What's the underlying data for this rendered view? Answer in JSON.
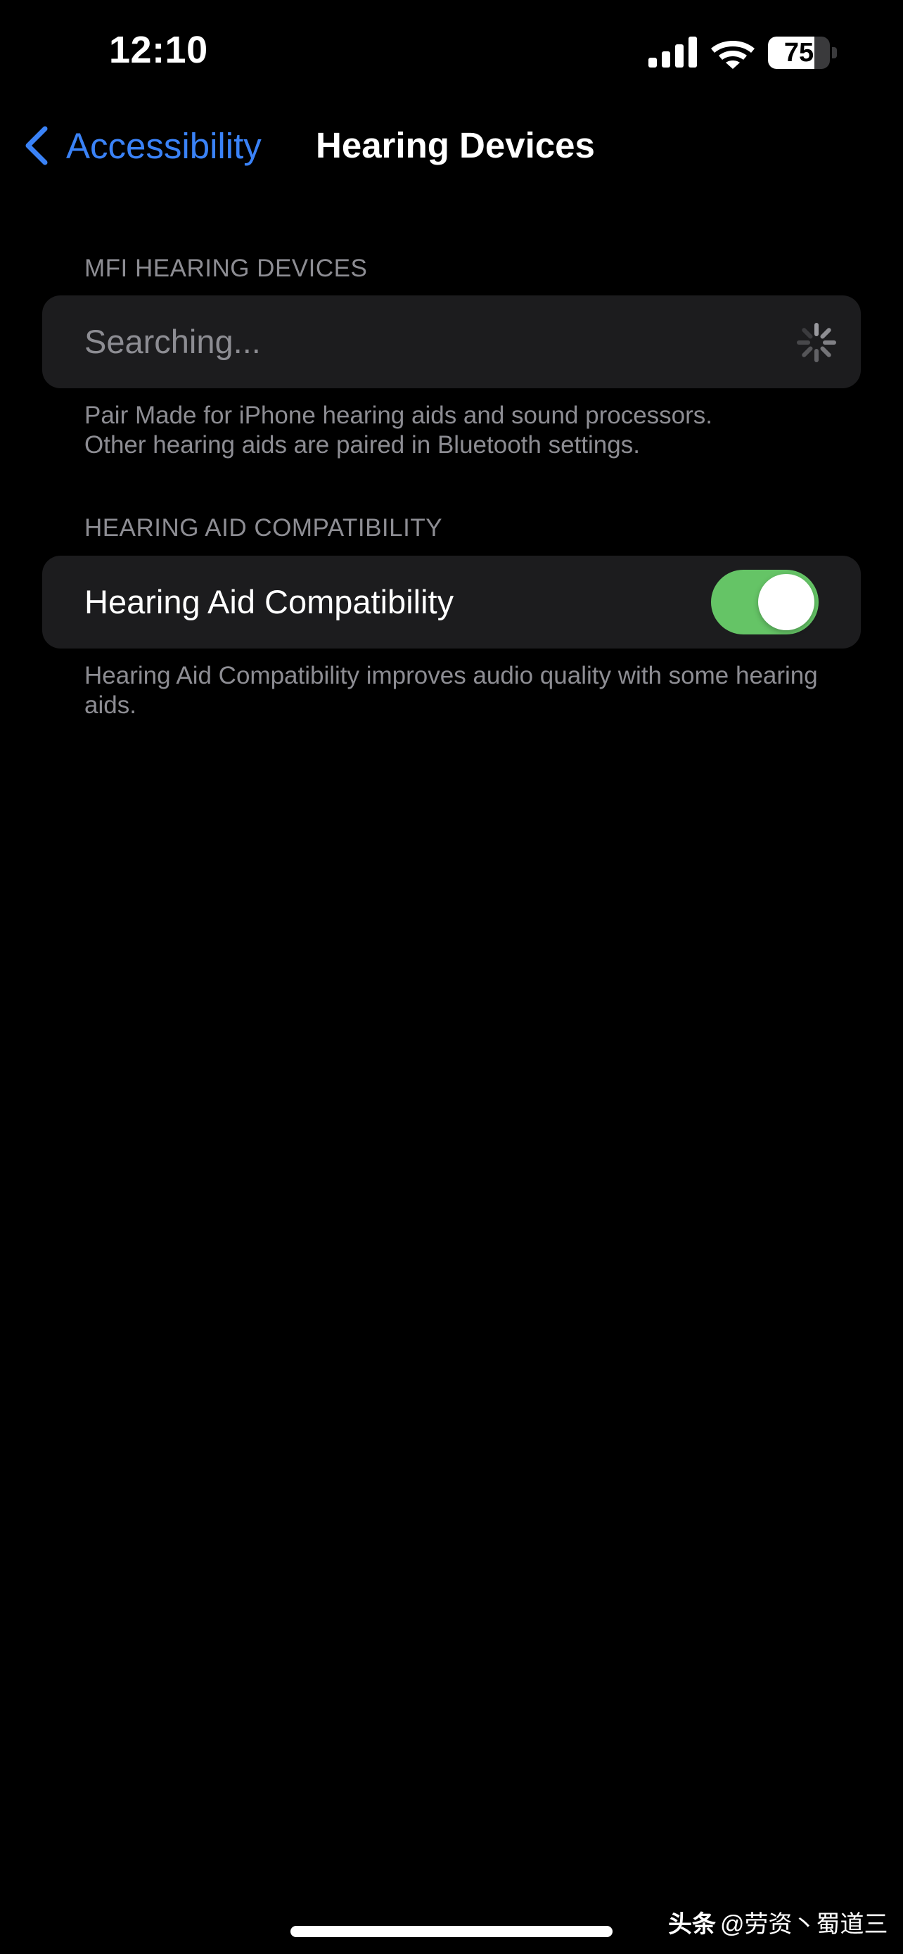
{
  "status_bar": {
    "time": "12:10",
    "battery_level": "75",
    "battery_fraction": 0.75
  },
  "nav": {
    "back_label": "Accessibility",
    "title": "Hearing Devices"
  },
  "mfi_section": {
    "header": "MFI HEARING DEVICES",
    "row_label": "Searching...",
    "footer_line1": "Pair Made for iPhone hearing aids and sound processors.",
    "footer_line2": "Other hearing aids are paired in Bluetooth settings."
  },
  "hac_section": {
    "header": "HEARING AID COMPATIBILITY",
    "row_label": "Hearing Aid Compatibility",
    "toggle_on": true,
    "footer": "Hearing Aid Compatibility improves audio quality with some hearing aids."
  },
  "watermark": {
    "logo": "头条",
    "handle": "@劳资丶蜀道三"
  },
  "colors": {
    "accent_blue": "#3a82f7",
    "toggle_green": "#65c466",
    "cell_background": "#1c1c1e",
    "secondary_text": "#8d8d93"
  },
  "icons": [
    "cellular-signal-icon",
    "wifi-icon",
    "battery-icon",
    "chevron-left-icon",
    "activity-spinner-icon"
  ]
}
